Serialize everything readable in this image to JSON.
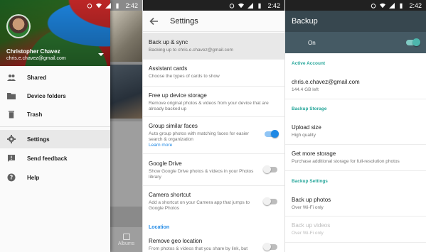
{
  "status_bar": {
    "time": "2:42"
  },
  "drawer": {
    "user_name": "Christopher Chavez",
    "user_email": "chris.e.chavez@gmail.com",
    "items": [
      {
        "label": "Shared",
        "icon": "people-icon"
      },
      {
        "label": "Device folders",
        "icon": "folder-icon"
      },
      {
        "label": "Trash",
        "icon": "trash-icon"
      },
      {
        "label": "Settings",
        "icon": "gear-icon",
        "active": true
      },
      {
        "label": "Send feedback",
        "icon": "feedback-icon"
      },
      {
        "label": "Help",
        "icon": "help-icon"
      }
    ],
    "albums_tab": "Albums"
  },
  "settings": {
    "title": "Settings",
    "items": [
      {
        "title": "Back up & sync",
        "subtitle": "Backing up to chris.e.chavez@gmail.com",
        "highlighted": true
      },
      {
        "title": "Assistant cards",
        "subtitle": "Choose the types of cards to show"
      },
      {
        "title": "Free up device storage",
        "subtitle": "Remove original photos & videos from your device that are already backed up"
      },
      {
        "title": "Group similar faces",
        "subtitle": "Auto group photos with matching faces for easier search & organization",
        "link": "Learn more",
        "toggle": true
      },
      {
        "title": "Google Drive",
        "subtitle": "Show Google Drive photos & videos in your Photos library",
        "toggle": false
      },
      {
        "title": "Camera shortcut",
        "subtitle": "Add a shortcut on your Camera app that jumps to Google Photos",
        "toggle": false
      },
      {
        "title": "Remove geo location",
        "subtitle": "From photos & videos that you share by link, but",
        "toggle": false
      }
    ],
    "location_section": "Location"
  },
  "backup": {
    "title": "Backup",
    "on_label": "On",
    "on": true,
    "active_account_section": "Active Account",
    "account_email": "chris.e.chavez@gmail.com",
    "account_storage": "144.4 GB left",
    "backup_storage_section": "Backup Storage",
    "upload_size_title": "Upload size",
    "upload_size_value": "High quality",
    "get_storage_title": "Get more storage",
    "get_storage_sub": "Purchase additional storage for full-resolution photos",
    "backup_settings_section": "Backup Settings",
    "backup_photos_title": "Back up photos",
    "backup_photos_sub": "Over Wi-Fi only",
    "backup_videos_title": "Back up videos",
    "backup_videos_sub": "Over Wi-Fi only"
  },
  "colors": {
    "accent_blue": "#1e88e5",
    "backup_toolbar": "#37474f",
    "backup_onbar": "#455a64",
    "teal": "#26a69a"
  }
}
